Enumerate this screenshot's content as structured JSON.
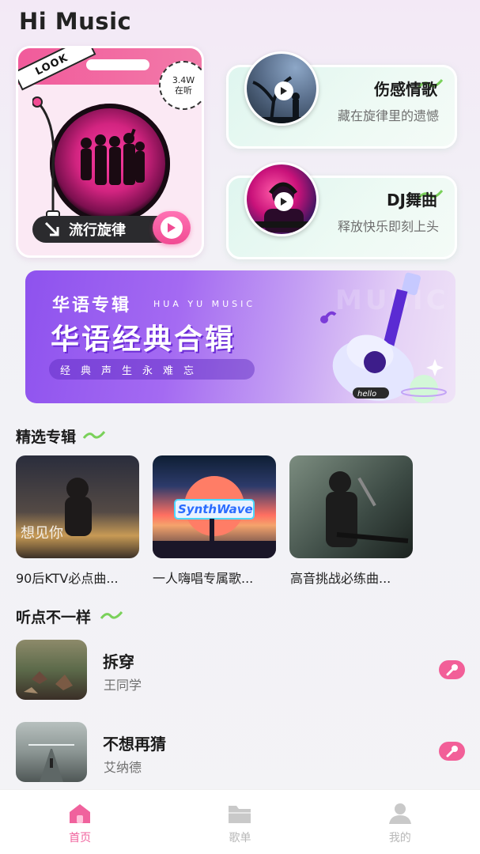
{
  "app": {
    "title": "Hi Music"
  },
  "feature_card": {
    "tag": "LOOK",
    "listen_count": "3.4W",
    "listen_label": "在听",
    "category": "流行旋律"
  },
  "side_cards": [
    {
      "title": "伤感情歌",
      "subtitle": "藏在旋律里的遗憾"
    },
    {
      "title": "DJ舞曲",
      "subtitle": "释放快乐即刻上头"
    }
  ],
  "banner": {
    "tag": "华语专辑",
    "pinyin": "HUA YU MUSIC",
    "headline": "华语经典合辑",
    "slogan": "经典声生永难忘",
    "ghost_text": "MUSIC",
    "guitar_label": "hello"
  },
  "featured_albums": {
    "title": "精选专辑",
    "items": [
      {
        "name": "90后KTV必点曲...",
        "cover_text": "想见你"
      },
      {
        "name": "一人嗨唱专属歌...",
        "cover_text": "SynthWave"
      },
      {
        "name": "高音挑战必练曲..."
      }
    ]
  },
  "songs": {
    "title": "听点不一样",
    "items": [
      {
        "title": "拆穿",
        "artist": "王同学"
      },
      {
        "title": "不想再猜",
        "artist": "艾纳德"
      }
    ]
  },
  "tabbar": [
    {
      "label": "首页",
      "icon": "home-icon",
      "active": true
    },
    {
      "label": "歌单",
      "icon": "folder-icon",
      "active": false
    },
    {
      "label": "我的",
      "icon": "profile-icon",
      "active": false
    }
  ],
  "colors": {
    "accent_pink": "#f25f98",
    "tab_active": "#f0629d",
    "banner_purple": "#8e52ee",
    "card_mint": "#dff6ef"
  }
}
